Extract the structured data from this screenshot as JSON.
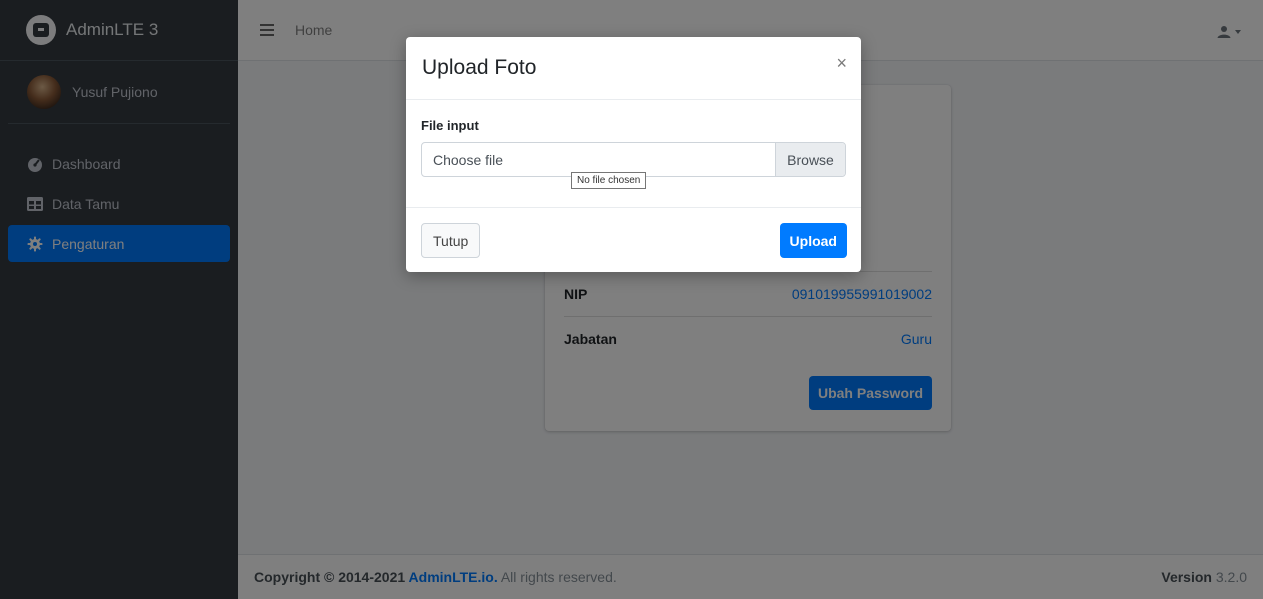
{
  "brand": {
    "title": "AdminLTE 3"
  },
  "user": {
    "name": "Yusuf Pujiono"
  },
  "sidebar": {
    "items": [
      {
        "label": "Dashboard",
        "icon": "tachometer-icon"
      },
      {
        "label": "Data Tamu",
        "icon": "table-icon"
      },
      {
        "label": "Pengaturan",
        "icon": "gear-icon",
        "active": true
      }
    ]
  },
  "navbar": {
    "home_label": "Home"
  },
  "profile": {
    "rows": [
      {
        "label": "NIP",
        "value": "091019955991019002"
      },
      {
        "label": "Jabatan",
        "value": "Guru"
      }
    ],
    "change_password_label": "Ubah Password"
  },
  "modal": {
    "title": "Upload Foto",
    "close_label": "×",
    "file_label": "File input",
    "file_placeholder": "Choose file",
    "browse_label": "Browse",
    "tooltip": "No file chosen",
    "close_button_label": "Tutup",
    "upload_button_label": "Upload"
  },
  "footer": {
    "copyright_prefix": "Copyright © 2014-2021 ",
    "copyright_link": "AdminLTE.io.",
    "copyright_suffix": " All rights reserved.",
    "version_label": "Version",
    "version_value": " 3.2.0"
  },
  "colors": {
    "primary": "#007bff",
    "sidebar": "#343a40"
  }
}
